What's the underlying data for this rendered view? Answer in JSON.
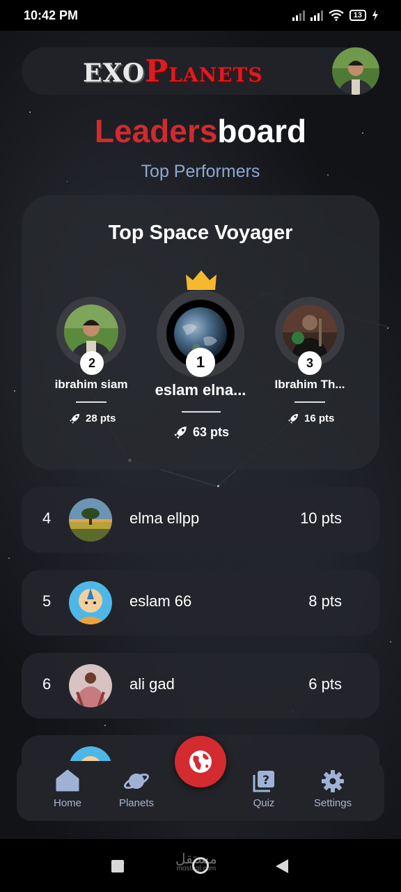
{
  "status_bar": {
    "time": "10:42 PM",
    "battery": "13"
  },
  "header": {
    "logo_exo": "EXO",
    "logo_p": "P",
    "logo_lanets": "LANETS"
  },
  "title": {
    "part1": "Leaders",
    "part2": "board"
  },
  "subtitle": "Top Performers",
  "podium": {
    "title": "Top Space Voyager",
    "first": {
      "rank": "1",
      "name": "eslam elna...",
      "points": "63 pts"
    },
    "second": {
      "rank": "2",
      "name": "ibrahim siam",
      "points": "28 pts"
    },
    "third": {
      "rank": "3",
      "name": "Ibrahim Th...",
      "points": "16 pts"
    }
  },
  "leaderboard": [
    {
      "rank": "4",
      "name": "elma ellpp",
      "points": "10 pts"
    },
    {
      "rank": "5",
      "name": "eslam 66",
      "points": "8 pts"
    },
    {
      "rank": "6",
      "name": "ali gad",
      "points": "6 pts"
    }
  ],
  "bottom_nav": {
    "home": "Home",
    "planets": "Planets",
    "quiz": "Quiz",
    "settings": "Settings"
  },
  "watermark": {
    "arabic": "مستقل",
    "latin": "mostaql.com"
  },
  "colors": {
    "accent": "#d02a2f",
    "subtitle": "#8ea8d2",
    "crown": "#f5b82e"
  },
  "icons": [
    "rocket-icon",
    "crown-icon",
    "home-icon",
    "planet-icon",
    "quiz-icon",
    "gear-icon",
    "globe-icon"
  ]
}
